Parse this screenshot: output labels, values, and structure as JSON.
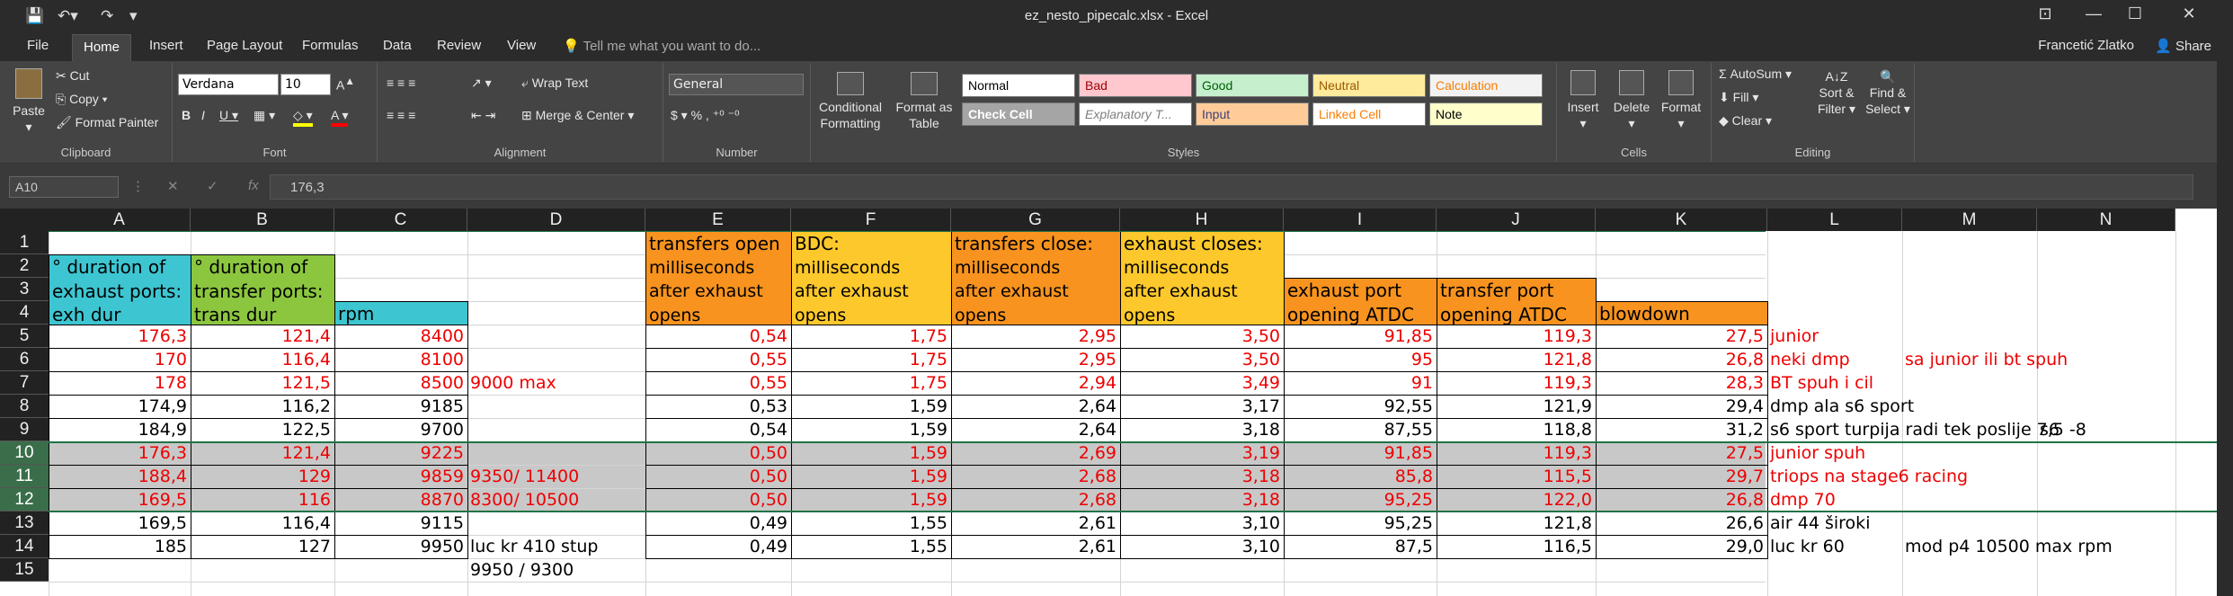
{
  "window": {
    "title": "ez_nesto_pipecalc.xlsx - Excel"
  },
  "tabs": [
    "File",
    "Home",
    "Insert",
    "Page Layout",
    "Formulas",
    "Data",
    "Review",
    "View"
  ],
  "tell_me": "Tell me what you want to do...",
  "user": "Francetić Zlatko",
  "share": "Share",
  "ribbon": {
    "clipboard": {
      "label": "Clipboard",
      "paste": "Paste",
      "cut": "Cut",
      "copy": "Copy",
      "painter": "Format Painter"
    },
    "font": {
      "label": "Font",
      "name": "Verdana",
      "size": "10"
    },
    "alignment": {
      "label": "Alignment",
      "wrap": "Wrap Text",
      "merge": "Merge & Center"
    },
    "number": {
      "label": "Number",
      "format": "General"
    },
    "styles": {
      "label": "Styles",
      "cond": "Conditional Formatting",
      "table": "Format as Table",
      "cells": [
        {
          "t": "Normal",
          "bg": "#ffffff",
          "fg": "#000000"
        },
        {
          "t": "Bad",
          "bg": "#ffc7ce",
          "fg": "#9c0006"
        },
        {
          "t": "Good",
          "bg": "#c6efce",
          "fg": "#006100"
        },
        {
          "t": "Neutral",
          "bg": "#ffeb9c",
          "fg": "#9c5700"
        },
        {
          "t": "Calculation",
          "bg": "#f2f2f2",
          "fg": "#fa7d00"
        },
        {
          "t": "Check Cell",
          "bg": "#a5a5a5",
          "fg": "#ffffff"
        },
        {
          "t": "Explanatory T...",
          "bg": "#ffffff",
          "fg": "#7f7f7f"
        },
        {
          "t": "Input",
          "bg": "#ffcc99",
          "fg": "#3f3f76"
        },
        {
          "t": "Linked Cell",
          "bg": "#ffffff",
          "fg": "#fa7d00"
        },
        {
          "t": "Note",
          "bg": "#ffffcc",
          "fg": "#000000"
        }
      ]
    },
    "cells": {
      "label": "Cells",
      "insert": "Insert",
      "delete": "Delete",
      "format": "Format"
    },
    "editing": {
      "label": "Editing",
      "autosum": "AutoSum",
      "fill": "Fill",
      "clear": "Clear",
      "sort": "Sort & Filter",
      "find": "Find & Select"
    }
  },
  "formula_bar": {
    "name_box": "A10",
    "formula": "176,3"
  },
  "columns": [
    "A",
    "B",
    "C",
    "D",
    "E",
    "F",
    "G",
    "H",
    "I",
    "J",
    "K",
    "L",
    "M",
    "N"
  ],
  "rows": [
    "1",
    "2",
    "3",
    "4",
    "5",
    "6",
    "7",
    "8",
    "9",
    "10",
    "11",
    "12",
    "13",
    "14",
    "15"
  ],
  "headers": {
    "A": [
      "° duration of",
      "exhaust ports:",
      "exh dur"
    ],
    "B": [
      "° duration of",
      "transfer ports:",
      "trans dur"
    ],
    "C": [
      "rpm"
    ],
    "E": [
      "transfers open",
      "milliseconds",
      "after exhaust",
      "opens"
    ],
    "F": [
      "BDC:",
      "milliseconds",
      "after exhaust",
      "opens"
    ],
    "G": [
      "transfers close:",
      "milliseconds",
      "after exhaust",
      "opens"
    ],
    "H": [
      "exhaust closes:",
      "milliseconds",
      "after exhaust",
      "opens"
    ],
    "I": [
      "exhaust port",
      "opening ATDC"
    ],
    "J": [
      "transfer port",
      "opening ATDC"
    ],
    "K": [
      "blowdown"
    ]
  },
  "data": [
    {
      "A": "176,3",
      "B": "121,4",
      "C": "8400",
      "D": "",
      "E": "0,54",
      "F": "1,75",
      "G": "2,95",
      "H": "3,50",
      "I": "91,85",
      "J": "119,3",
      "K": "27,5",
      "L": "junior",
      "M": "",
      "red": true
    },
    {
      "A": "170",
      "B": "116,4",
      "C": "8100",
      "D": "",
      "E": "0,55",
      "F": "1,75",
      "G": "2,95",
      "H": "3,50",
      "I": "95",
      "J": "121,8",
      "K": "26,8",
      "L": "neki dmp",
      "M": "sa junior ili bt spuh",
      "red": true
    },
    {
      "A": "178",
      "B": "121,5",
      "C": "8500",
      "D": "9000 max",
      "E": "0,55",
      "F": "1,75",
      "G": "2,94",
      "H": "3,49",
      "I": "91",
      "J": "119,3",
      "K": "28,3",
      "L": "BT spuh i cil",
      "M": "",
      "red": true
    },
    {
      "A": "174,9",
      "B": "116,2",
      "C": "9185",
      "D": "",
      "E": "0,53",
      "F": "1,59",
      "G": "2,64",
      "H": "3,17",
      "I": "92,55",
      "J": "121,9",
      "K": "29,4",
      "L": "dmp ala s6 sport",
      "M": "",
      "red": false
    },
    {
      "A": "184,9",
      "B": "122,5",
      "C": "9700",
      "D": "",
      "E": "0,54",
      "F": "1,59",
      "G": "2,64",
      "H": "3,18",
      "I": "87,55",
      "J": "118,8",
      "K": "31,2",
      "L": "s6 sport turpija radi tek poslije 7,5 -8",
      "M": "",
      "red": false,
      "N": "s6"
    },
    {
      "A": "176,3",
      "B": "121,4",
      "C": "9225",
      "D": "",
      "E": "0,50",
      "F": "1,59",
      "G": "2,69",
      "H": "3,19",
      "I": "91,85",
      "J": "119,3",
      "K": "27,5",
      "L": "junior spuh",
      "M": "",
      "red": true
    },
    {
      "A": "188,4",
      "B": "129",
      "C": "9859",
      "D": "9350/ 11400",
      "E": "0,50",
      "F": "1,59",
      "G": "2,68",
      "H": "3,18",
      "I": "85,8",
      "J": "115,5",
      "K": "29,7",
      "L": "triops na stage6 racing",
      "M": "",
      "red": true
    },
    {
      "A": "169,5",
      "B": "116",
      "C": "8870",
      "D": "8300/ 10500",
      "E": "0,50",
      "F": "1,59",
      "G": "2,68",
      "H": "3,18",
      "I": "95,25",
      "J": "122,0",
      "K": "26,8",
      "L": "dmp 70",
      "M": "",
      "red": true
    },
    {
      "A": "169,5",
      "B": "116,4",
      "C": "9115",
      "D": "",
      "E": "0,49",
      "F": "1,55",
      "G": "2,61",
      "H": "3,10",
      "I": "95,25",
      "J": "121,8",
      "K": "26,6",
      "L": "air 44 široki",
      "M": "",
      "red": false
    },
    {
      "A": "185",
      "B": "127",
      "C": "9950",
      "D": "luc kr  410 stup",
      "E": "0,49",
      "F": "1,55",
      "G": "2,61",
      "H": "3,10",
      "I": "87,5",
      "J": "116,5",
      "K": "29,0",
      "L": "luc kr 60",
      "M": "mod p4 10500 max rpm",
      "red": false
    }
  ],
  "row15_D": "9950 /  9300",
  "colors": {
    "cyan": "#3dc6d2",
    "green": "#8cc63f",
    "orange": "#f7931e",
    "yellow": "#fcc82b"
  }
}
